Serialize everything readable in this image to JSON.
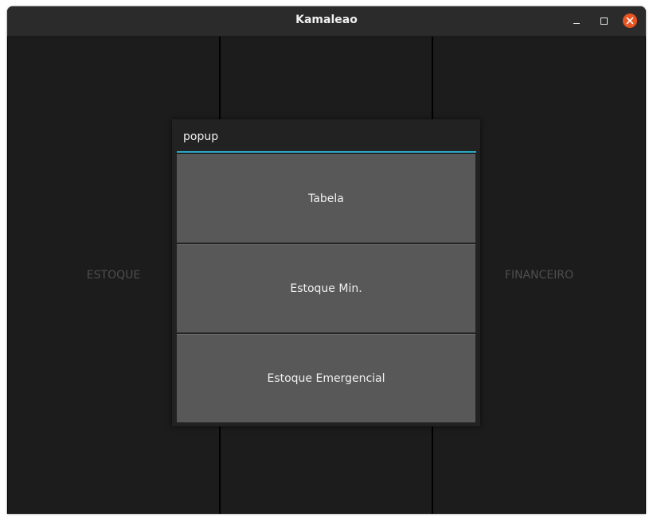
{
  "window": {
    "title": "Kamaleao",
    "controls": {
      "minimize_icon": "minimize-icon",
      "maximize_icon": "maximize-icon",
      "close_icon": "close-icon",
      "close_color": "#e95420"
    }
  },
  "panels": [
    {
      "label": "ESTOQUE"
    },
    {
      "label": ""
    },
    {
      "label": "FINANCEIRO"
    }
  ],
  "popup": {
    "title": "popup",
    "accent_color": "#2aa8c4",
    "buttons": [
      {
        "label": "Tabela"
      },
      {
        "label": "Estoque Min."
      },
      {
        "label": "Estoque Emergencial"
      }
    ]
  }
}
